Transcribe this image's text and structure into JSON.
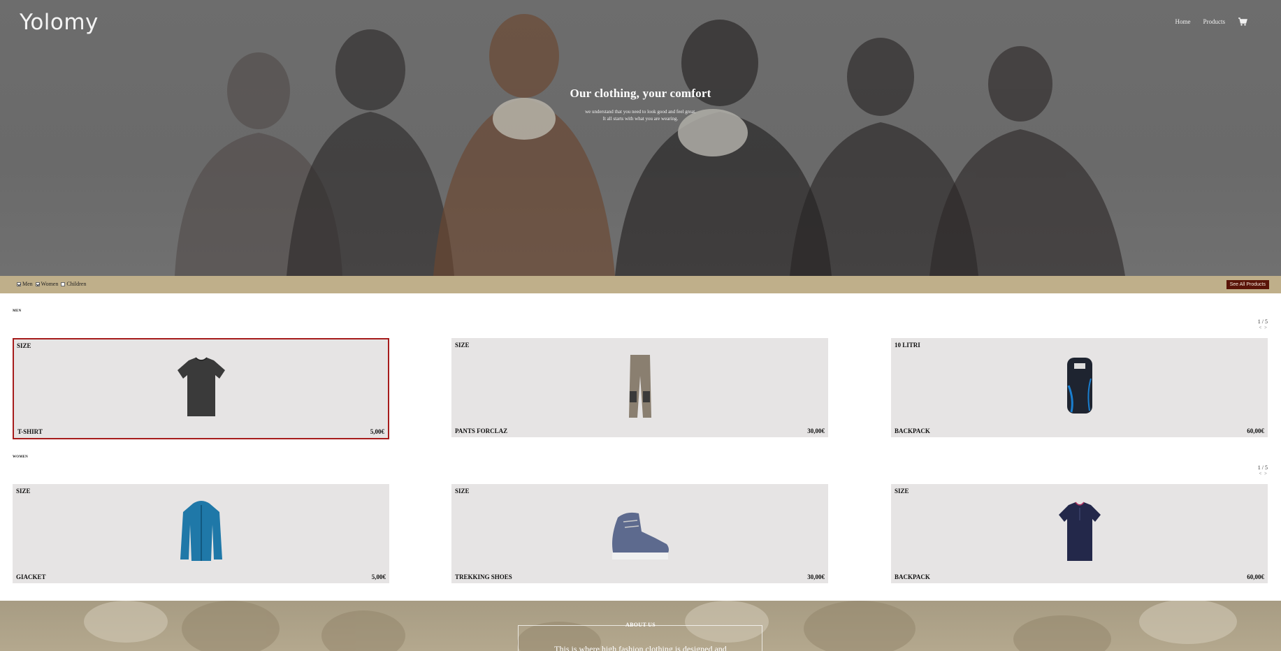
{
  "header": {
    "logo": "Yolomy",
    "nav": [
      "Home",
      "Products"
    ]
  },
  "hero": {
    "title": "Our clothing, your comfort",
    "subtitle_line1": "we understand that you need to look good and feel great.",
    "subtitle_line2": "It all starts with what you are wearing."
  },
  "filters": {
    "items": [
      {
        "label": "Men",
        "checked": true
      },
      {
        "label": "Women",
        "checked": true
      },
      {
        "label": "Children",
        "checked": false
      }
    ],
    "see_all_label": "See All Products"
  },
  "sections": [
    {
      "title": "MEN",
      "pager": "1 / 5",
      "arrows": "< >",
      "products": [
        {
          "tag": "SIZE",
          "name": "T-SHIRT",
          "price": "5,00€",
          "selected": true,
          "icon": "tshirt-icon"
        },
        {
          "tag": "SIZE",
          "name": "PANTS FORCLAZ",
          "price": "30,00€",
          "selected": false,
          "icon": "pants-icon"
        },
        {
          "tag": "10 LITRI",
          "name": "BACKPACK",
          "price": "60,00€",
          "selected": false,
          "icon": "backpack-icon"
        }
      ]
    },
    {
      "title": "WOMEN",
      "pager": "1 / 5",
      "arrows": "< >",
      "products": [
        {
          "tag": "SIZE",
          "name": "GIACKET",
          "price": "5,00€",
          "selected": false,
          "icon": "jacket-icon"
        },
        {
          "tag": "SIZE",
          "name": "TREKKING SHOES",
          "price": "30,00€",
          "selected": false,
          "icon": "shoe-icon"
        },
        {
          "tag": "SIZE",
          "name": "BACKPACK",
          "price": "60,00€",
          "selected": false,
          "icon": "blouse-icon"
        }
      ]
    }
  ],
  "about": {
    "title": "ABOUT US",
    "text": "This is where high fashion clothing is designed and"
  },
  "colors": {
    "filter_bar": "#bfaf8a",
    "see_all_button": "#5a1408",
    "selected_border": "#a61c1c",
    "card_bg": "#e6e4e4"
  }
}
